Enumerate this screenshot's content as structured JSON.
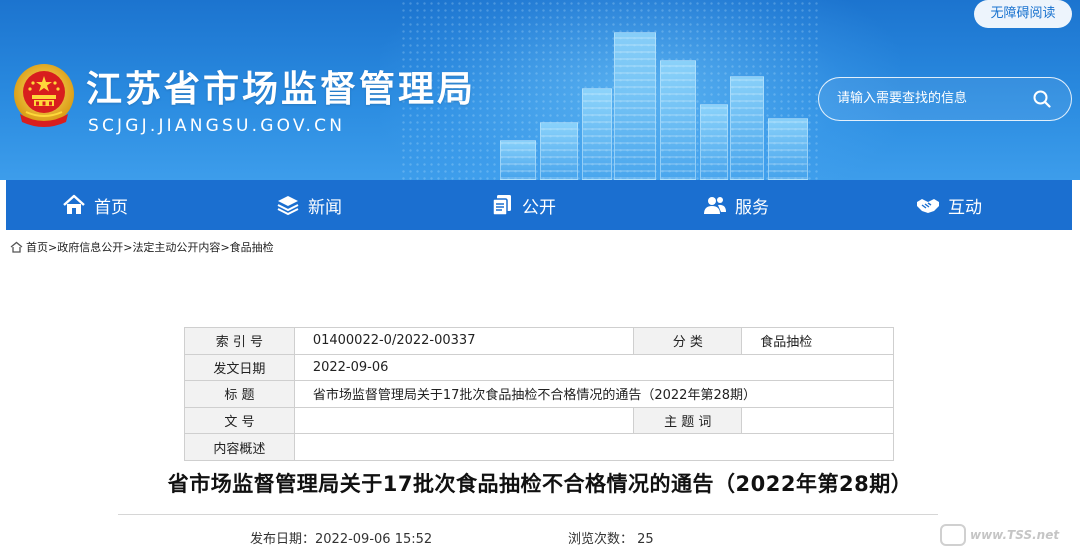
{
  "header": {
    "site_title": "江苏省市场监督管理局",
    "site_domain": "SCJGJ.JIANGSU.GOV.CN",
    "accessibility_label": "无障碍阅读",
    "search_placeholder": "请输入需要查找的信息",
    "emblem_icon": "national-emblem-icon",
    "theme_color": "#1b6fd0"
  },
  "nav": {
    "items": [
      {
        "label": "首页",
        "icon": "home-icon"
      },
      {
        "label": "新闻",
        "icon": "layers-icon"
      },
      {
        "label": "公开",
        "icon": "document-stack-icon"
      },
      {
        "label": "服务",
        "icon": "users-icon"
      },
      {
        "label": "互动",
        "icon": "handshake-icon"
      }
    ]
  },
  "breadcrumb": {
    "home": "首页",
    "sep": ">",
    "items": [
      "政府信息公开",
      "法定主动公开内容",
      "食品抽检"
    ]
  },
  "meta_table": {
    "index_label": "索 引 号",
    "index_value": "01400022-0/2022-00337",
    "category_label": "分 类",
    "category_value": "食品抽检",
    "date_label": "发文日期",
    "date_value": "2022-09-06",
    "title_label": "标 题",
    "title_value": "省市场监督管理局关于17批次食品抽检不合格情况的通告（2022年第28期）",
    "docno_label": "文 号",
    "docno_value": "",
    "keywords_label": "主 题 词",
    "keywords_value": "",
    "summary_label": "内容概述",
    "summary_value": ""
  },
  "article": {
    "title": "省市场监督管理局关于17批次食品抽检不合格情况的通告（2022年第28期）",
    "publish_label": "发布日期：",
    "publish_value": "2022-09-06 15:52",
    "views_label": "浏览次数：",
    "views_value": "25"
  },
  "watermark": {
    "text": "www.TSS.net"
  }
}
